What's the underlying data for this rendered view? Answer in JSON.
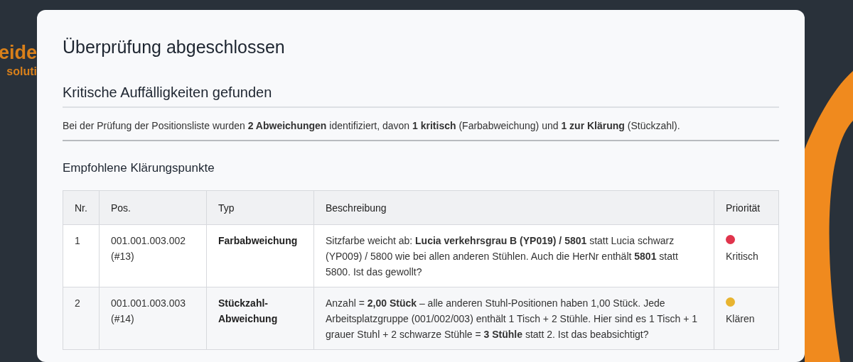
{
  "logo": {
    "line_1": "eide",
    "line_2": "soluti"
  },
  "title": "Überprüfung abgeschlossen",
  "section": {
    "heading": "Kritische Auffälligkeiten gefunden",
    "summary": "Bei der Prüfung der Positionsliste wurden **2 Abweichungen** identifiziert, davon **1 kritisch** (Farbabweichung) und **1 zur Klärung** (Stückzahl)."
  },
  "table": {
    "heading": "Empfohlene Klärungspunkte",
    "columns": [
      "Nr.",
      "Pos.",
      "Typ",
      "Beschreibung",
      "Priorität"
    ],
    "rows": [
      {
        "nr": "1",
        "pos": "001.001.003.002 (#13)",
        "typ": "Farbabweichung",
        "beschreibung": "Sitzfarbe weicht ab: **Lucia verkehrsgrau B (YP019) / 5801** statt Lucia schwarz (YP009) / 5800 wie bei allen anderen Stühlen. Auch die HerNr enthält **5801** statt 5800. Ist das gewollt?",
        "priority": "Kritisch",
        "color": "#e0344c"
      },
      {
        "nr": "2",
        "pos": "001.001.003.003 (#14)",
        "typ": "Stückzahl-Abweichung",
        "beschreibung": "Anzahl = **2,00 Stück** – alle anderen Stuhl-Positionen haben 1,00 Stück. Jede Arbeitsplatzgruppe (001/002/003) enthält 1 Tisch + 2 Stühle. Hier sind es 1 Tisch + 1 grauer Stuhl + 2 schwarze Stühle = **3 Stühle** statt 2. Ist das beabsichtigt?",
        "priority": "Klären",
        "color": "#e8b430"
      }
    ]
  }
}
